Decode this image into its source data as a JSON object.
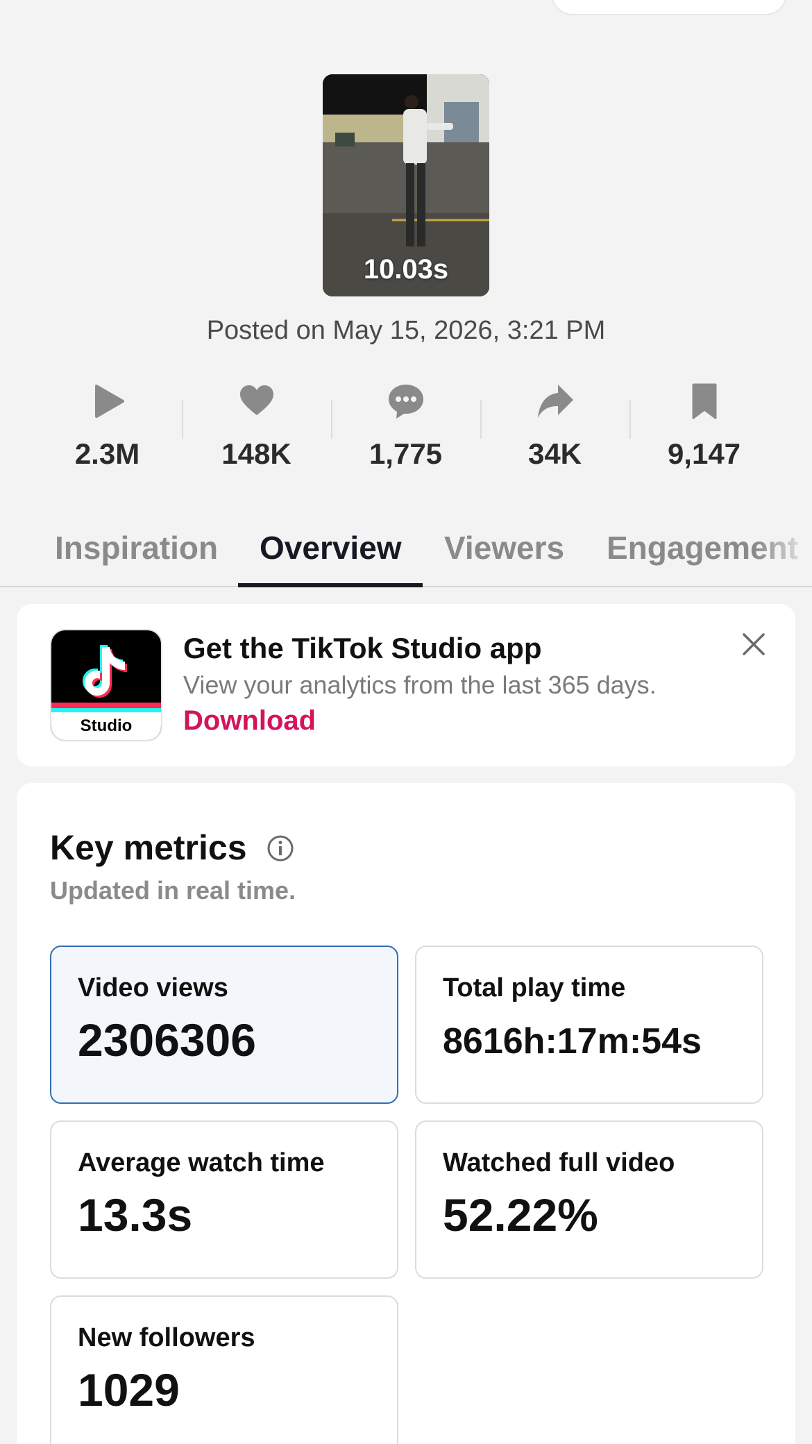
{
  "video": {
    "duration": "10.03s",
    "posted": "Posted on May 15, 2026, 3:21 PM"
  },
  "stats": [
    {
      "icon": "play-icon",
      "value": "2.3M"
    },
    {
      "icon": "heart-icon",
      "value": "148K"
    },
    {
      "icon": "comment-icon",
      "value": "1,775"
    },
    {
      "icon": "share-icon",
      "value": "34K"
    },
    {
      "icon": "bookmark-icon",
      "value": "9,147"
    }
  ],
  "tabs": [
    {
      "label": "Inspiration",
      "active": false
    },
    {
      "label": "Overview",
      "active": true
    },
    {
      "label": "Viewers",
      "active": false
    },
    {
      "label": "Engagement",
      "active": false
    }
  ],
  "promo": {
    "logo_text": "Studio",
    "title": "Get the TikTok Studio app",
    "subtitle": "View your analytics from the last 365 days.",
    "link": "Download"
  },
  "metrics": {
    "title": "Key metrics",
    "subtitle": "Updated in real time.",
    "cards": [
      {
        "label": "Video views",
        "value": "2306306",
        "selected": true
      },
      {
        "label": "Total play time",
        "value": "8616h:17m:54s",
        "selected": false
      },
      {
        "label": "Average watch time",
        "value": "13.3s",
        "selected": false
      },
      {
        "label": "Watched full video",
        "value": "52.22%",
        "selected": false
      },
      {
        "label": "New followers",
        "value": "1029",
        "selected": false
      }
    ]
  },
  "colors": {
    "accent_link": "#d4145a",
    "selected_border": "#2f6fb6",
    "tiktok_cyan": "#25f4ee",
    "tiktok_red": "#fe2c55"
  }
}
